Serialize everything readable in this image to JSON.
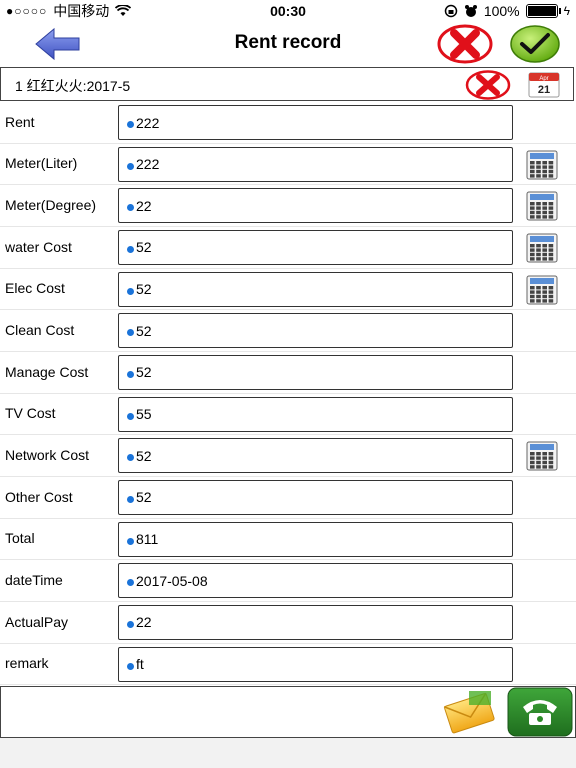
{
  "status": {
    "carrier": "中国移动",
    "time": "00:30",
    "battery": "100%",
    "battery_level": 1.0
  },
  "header": {
    "title": "Rent record"
  },
  "record": {
    "label": "1 红红火火:2017-5",
    "calendar_month": "Apr",
    "calendar_day": "21"
  },
  "rows": [
    {
      "label": "Rent",
      "value": "222",
      "calculator": false
    },
    {
      "label": "Meter(Liter)",
      "value": "222",
      "calculator": true
    },
    {
      "label": "Meter(Degree)",
      "value": "22",
      "calculator": true
    },
    {
      "label": "water Cost",
      "value": "52",
      "calculator": true
    },
    {
      "label": "Elec Cost",
      "value": "52",
      "calculator": true
    },
    {
      "label": "Clean Cost",
      "value": "52",
      "calculator": false
    },
    {
      "label": "Manage Cost",
      "value": "52",
      "calculator": false
    },
    {
      "label": "TV Cost",
      "value": "55",
      "calculator": false
    },
    {
      "label": "Network Cost",
      "value": "52",
      "calculator": true
    },
    {
      "label": "Other Cost",
      "value": "52",
      "calculator": false
    },
    {
      "label": "Total",
      "value": "811",
      "calculator": false
    },
    {
      "label": "dateTime",
      "value": "2017-05-08",
      "calculator": false
    },
    {
      "label": "ActualPay",
      "value": "22",
      "calculator": false
    },
    {
      "label": "remark",
      "value": "ft",
      "calculator": false
    }
  ],
  "colors": {
    "accent_blue": "#1a73d9",
    "cancel_red": "#e0101a",
    "ok_green": "#7cc417",
    "back_arrow": "#5a6fd6"
  },
  "icons": {
    "back": "back-arrow-icon",
    "cancel": "red-x-icon",
    "ok": "green-check-icon",
    "calendar": "calendar-icon",
    "calculator": "calculator-icon",
    "message": "envelope-icon",
    "phone": "phone-icon"
  }
}
